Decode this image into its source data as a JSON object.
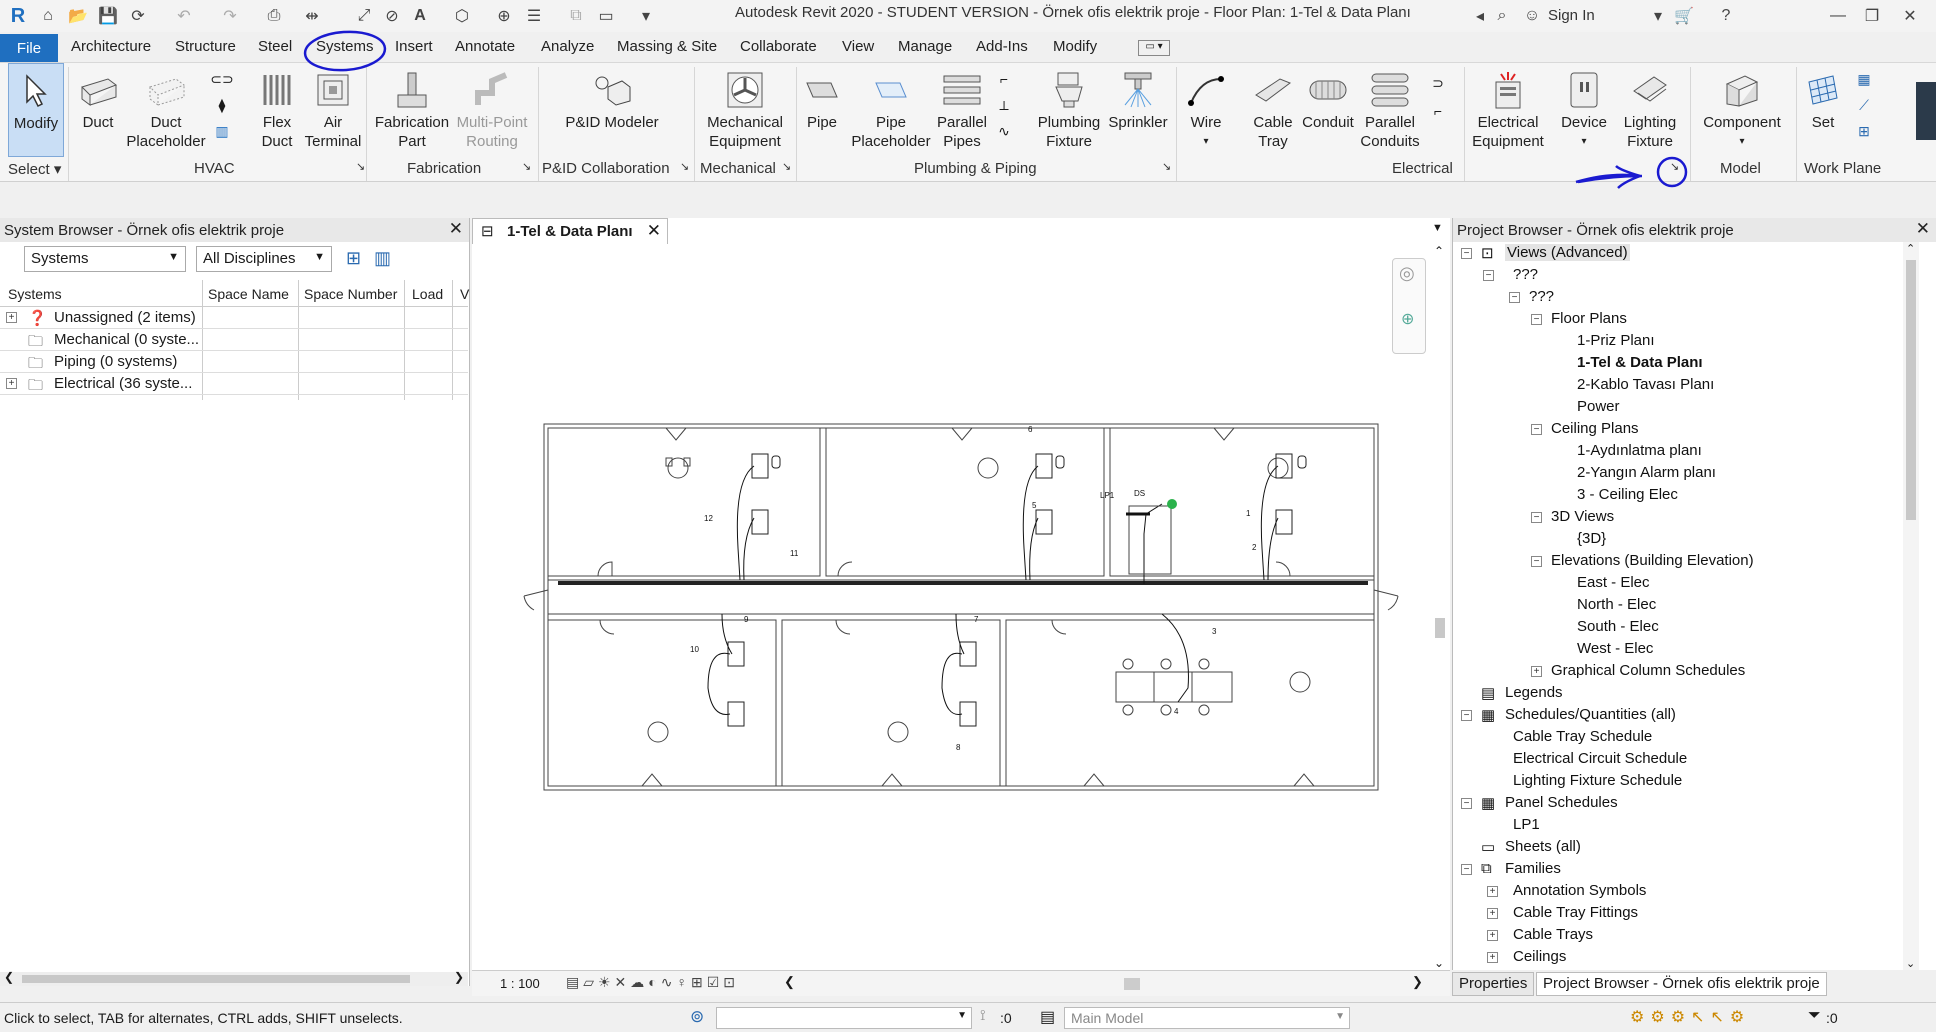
{
  "app": {
    "title": "Autodesk Revit 2020 - STUDENT VERSION - Örnek ofis elektrik proje - Floor Plan: 1-Tel & Data Planı",
    "sign_in": "Sign In"
  },
  "tabs": [
    "File",
    "Architecture",
    "Structure",
    "Steel",
    "Systems",
    "Insert",
    "Annotate",
    "Analyze",
    "Massing & Site",
    "Collaborate",
    "View",
    "Manage",
    "Add-Ins",
    "Modify"
  ],
  "ribbon": {
    "buttons": {
      "modify": "Modify",
      "duct": "Duct",
      "duct_placeholder": "Duct\nPlaceholder",
      "flex_duct": "Flex\nDuct",
      "air_terminal": "Air\nTerminal",
      "fabrication_part": "Fabrication\nPart",
      "multi_point_routing": "Multi-Point\nRouting",
      "pid_modeler": "P&ID Modeler",
      "mechanical_equipment": "Mechanical\nEquipment",
      "pipe": "Pipe",
      "pipe_placeholder": "Pipe\nPlaceholder",
      "parallel_pipes": "Parallel\nPipes",
      "plumbing_fixture": "Plumbing\nFixture",
      "sprinkler": "Sprinkler",
      "wire": "Wire",
      "cable_tray": "Cable\nTray",
      "conduit": "Conduit",
      "parallel_conduits": "Parallel\nConduits",
      "electrical_equipment": "Electrical\nEquipment",
      "device": "Device",
      "lighting_fixture": "Lighting\nFixture",
      "component": "Component",
      "set": "Set"
    },
    "panels": {
      "select": "Select",
      "hvac": "HVAC",
      "fabrication": "Fabrication",
      "pid_collaboration": "P&ID Collaboration",
      "mechanical": "Mechanical",
      "plumbing_piping": "Plumbing & Piping",
      "electrical": "Electrical",
      "model": "Model",
      "work_plane": "Work Plane"
    }
  },
  "system_browser": {
    "title": "System Browser - Örnek ofis elektrik proje",
    "filter1": "Systems",
    "filter2": "All Disciplines",
    "columns": [
      "Systems",
      "Space Name",
      "Space Number",
      "Load",
      "V"
    ],
    "rows": [
      {
        "label": "Unassigned (2 items)"
      },
      {
        "label": "Mechanical (0 syste..."
      },
      {
        "label": "Piping (0 systems)"
      },
      {
        "label": "Electrical (36 syste..."
      }
    ]
  },
  "view": {
    "tab_label": "1-Tel & Data Planı",
    "scale": "1 : 100",
    "plan_labels": {
      "lp1": "LP1",
      "ds": "DS",
      "circuits": [
        "1",
        "2",
        "3",
        "4",
        "5",
        "6",
        "7",
        "8",
        "9",
        "10",
        "11",
        "12"
      ]
    }
  },
  "project_browser": {
    "title": "Project Browser - Örnek ofis elektrik proje",
    "items": [
      "Views (Advanced)",
      "???",
      "???",
      "Floor Plans",
      "1-Priz Planı",
      "1-Tel & Data Planı",
      "2-Kablo Tavası Planı",
      "Power",
      "Ceiling Plans",
      "1-Aydınlatma planı",
      "2-Yangın Alarm planı",
      "3 - Ceiling Elec",
      "3D Views",
      "{3D}",
      "Elevations (Building Elevation)",
      "East - Elec",
      "North - Elec",
      "South - Elec",
      "West - Elec",
      "Graphical Column Schedules",
      "Legends",
      "Schedules/Quantities (all)",
      "Cable Tray Schedule",
      "Electrical Circuit Schedule",
      "Lighting Fixture Schedule",
      "Panel Schedules",
      "LP1",
      "Sheets (all)",
      "Families",
      "Annotation Symbols",
      "Cable Tray Fittings",
      "Cable Trays",
      "Ceilings"
    ],
    "bottom_tabs": [
      "Properties",
      "Project Browser - Örnek ofis elektrik proje"
    ]
  },
  "status": {
    "hint": "Click to select, TAB for alternates, CTRL adds, SHIFT unselects.",
    "count": ":0",
    "model": "Main Model",
    "filter_count": ":0"
  },
  "colors": {
    "accent": "#1f6fc0",
    "annotation": "#1a1ad0"
  }
}
